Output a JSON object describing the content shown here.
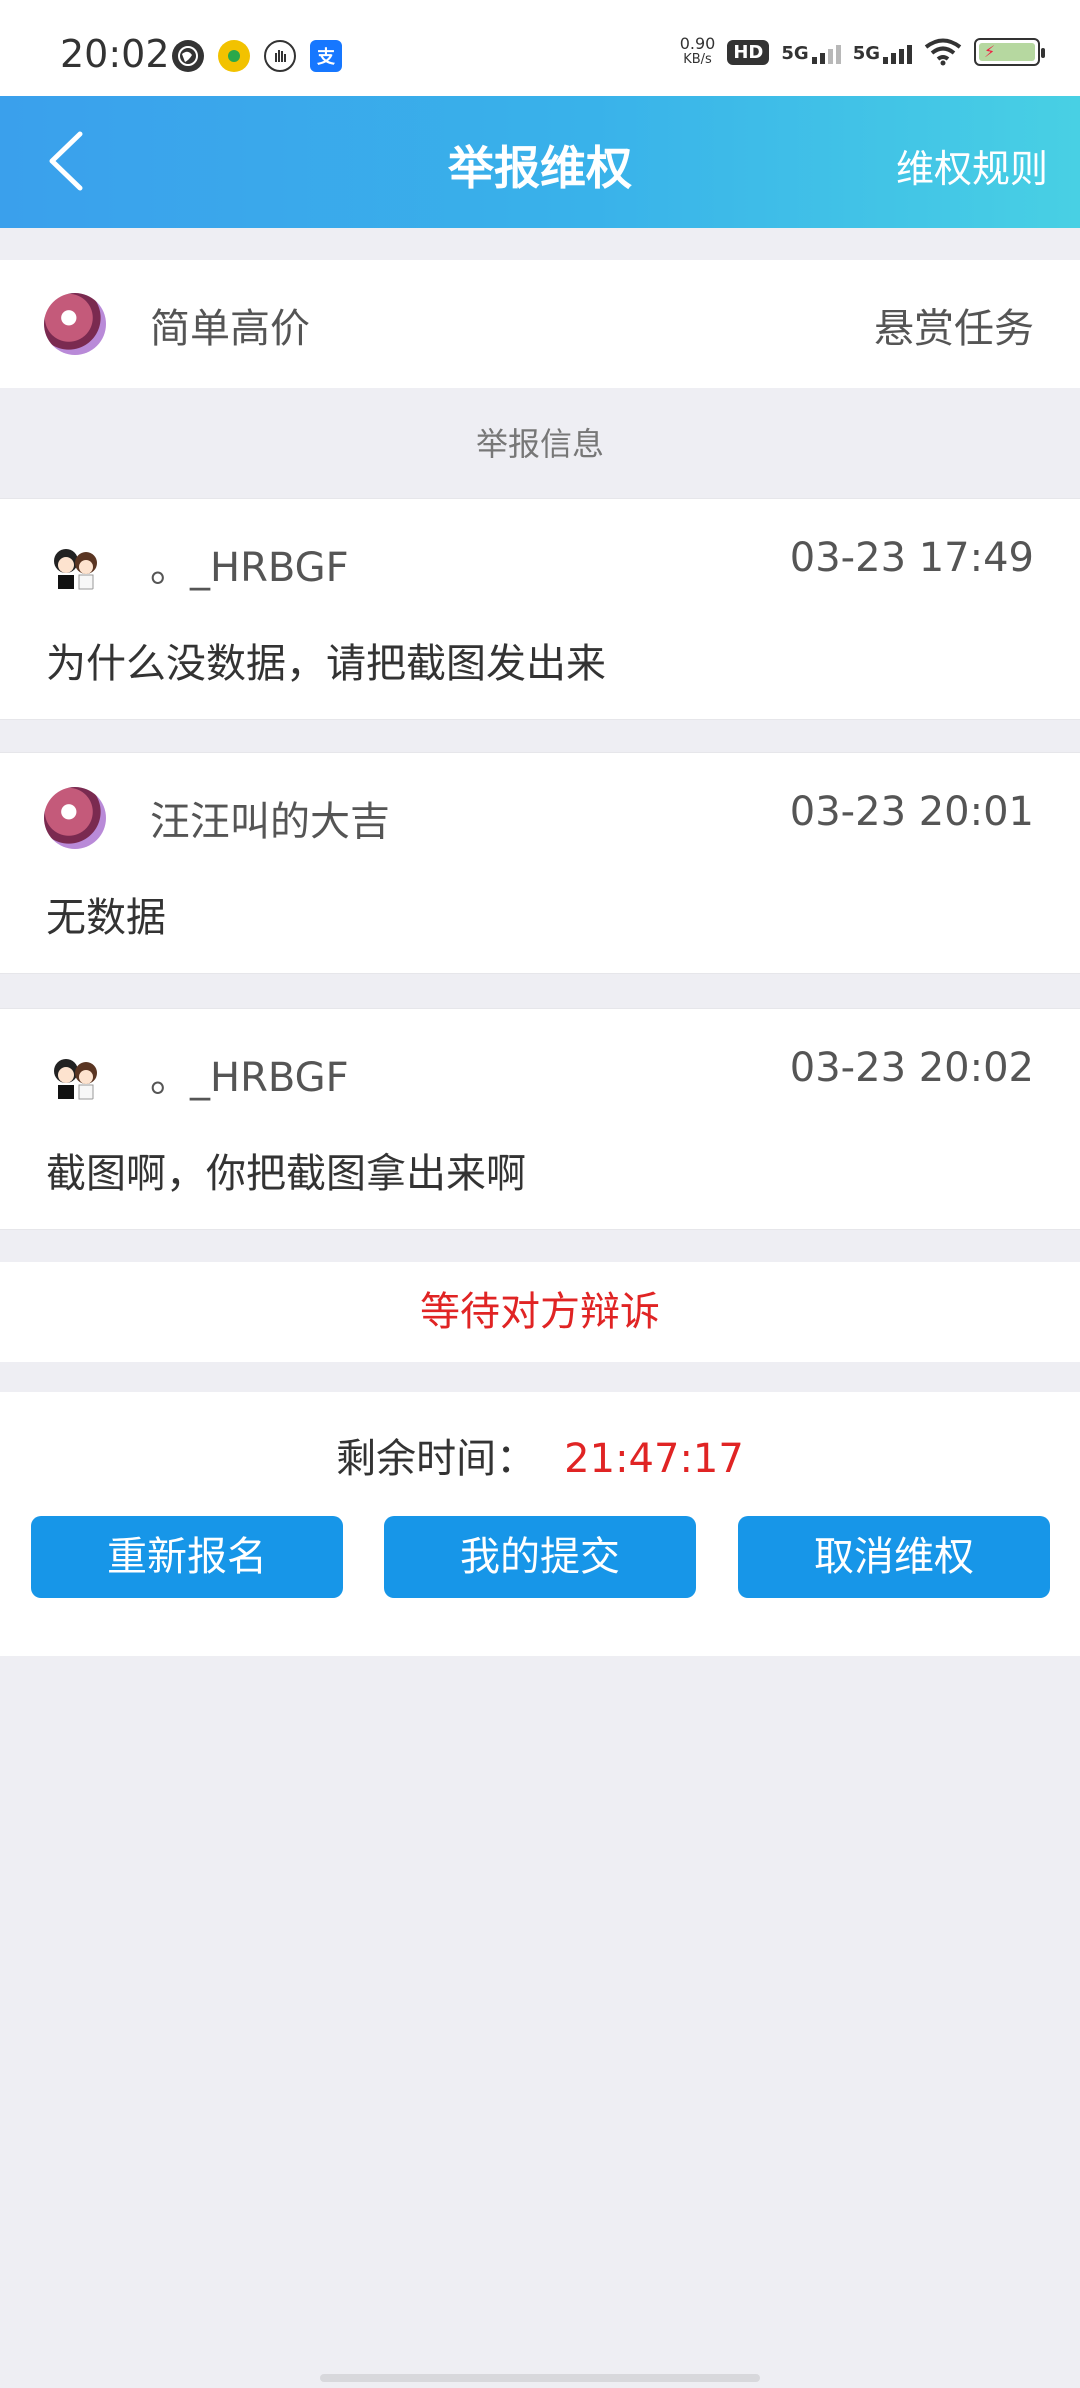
{
  "status_bar": {
    "time": "20:02",
    "net_speed": "0.90",
    "net_unit": "KB/s",
    "hd_label": "HD",
    "sim1_label": "5G",
    "sim2_label": "5G",
    "pay_icon_label": "支"
  },
  "header": {
    "title": "举报维权",
    "right_link": "维权规则"
  },
  "task": {
    "name": "简单高价",
    "type": "悬赏任务"
  },
  "section_title": "举报信息",
  "messages": [
    {
      "name": "。_HRBGF",
      "time": "03-23 17:49",
      "text": "为什么没数据，请把截图发出来",
      "avatar": "couple-avatar"
    },
    {
      "name": "汪汪叫的大吉",
      "time": "03-23 20:01",
      "text": "无数据",
      "avatar": "mascot-avatar"
    },
    {
      "name": "。_HRBGF",
      "time": "03-23 20:02",
      "text": "截图啊，你把截图拿出来啊",
      "avatar": "couple-avatar"
    }
  ],
  "status_text": "等待对方辩诉",
  "remaining": {
    "label": "剩余时间：",
    "value": "21:47:17"
  },
  "buttons": {
    "reapply": "重新报名",
    "my_submission": "我的提交",
    "cancel_claim": "取消维权"
  },
  "colors": {
    "header_start": "#3aa0ec",
    "header_end": "#48d0e4",
    "button": "#1796e8",
    "alert_red": "#e02424",
    "background": "#eeeef3"
  }
}
